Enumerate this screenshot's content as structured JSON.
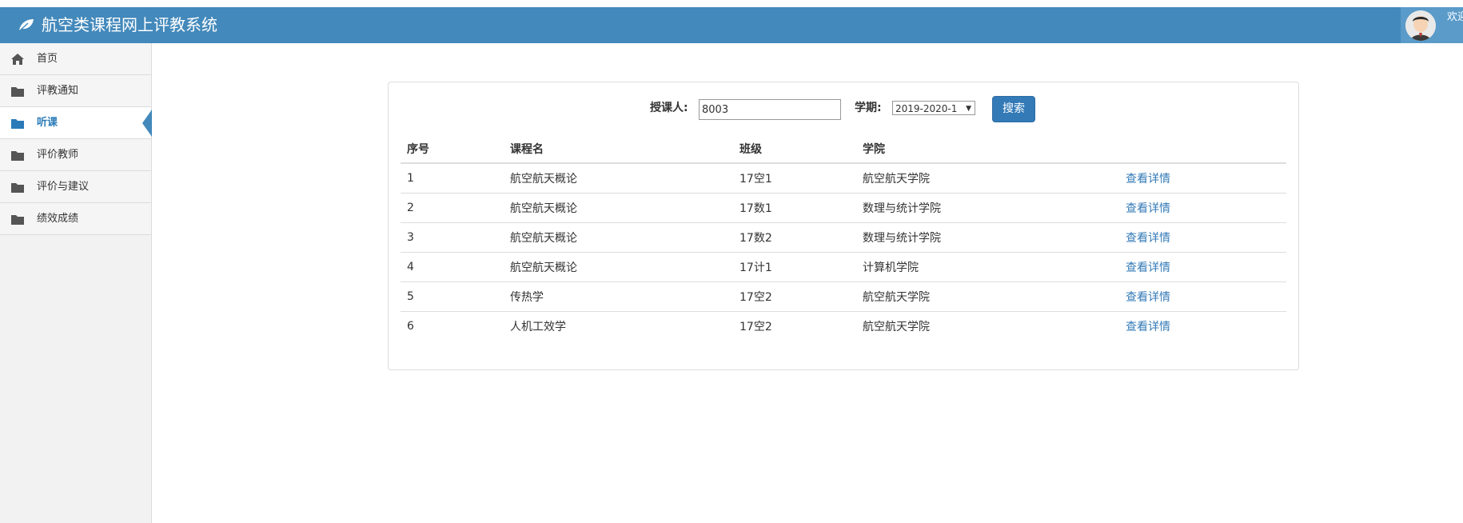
{
  "header": {
    "title": "航空类课程网上评教系统",
    "user_text": "欢迎 张三"
  },
  "sidebar": {
    "items": [
      {
        "label": "首页",
        "icon": "home-icon"
      },
      {
        "label": "评教通知",
        "icon": "folder-icon"
      },
      {
        "label": "听课",
        "icon": "folder-icon",
        "active": true
      },
      {
        "label": "评价教师",
        "icon": "folder-icon"
      },
      {
        "label": "评价与建议",
        "icon": "folder-icon"
      },
      {
        "label": "绩效成绩",
        "icon": "folder-icon"
      }
    ]
  },
  "search": {
    "teacher_label": "授课人:",
    "teacher_value": "8003",
    "term_label": "学期:",
    "term_value": "2019-2020-1",
    "button_label": "搜索"
  },
  "table": {
    "headers": [
      "序号",
      "课程名",
      "班级",
      "学院",
      ""
    ],
    "rows": [
      {
        "no": "1",
        "course": "航空航天概论",
        "class": "17空1",
        "college": "航空航天学院",
        "action": "查看详情"
      },
      {
        "no": "2",
        "course": "航空航天概论",
        "class": "17数1",
        "college": "数理与统计学院",
        "action": "查看详情"
      },
      {
        "no": "3",
        "course": "航空航天概论",
        "class": "17数2",
        "college": "数理与统计学院",
        "action": "查看详情"
      },
      {
        "no": "4",
        "course": "航空航天概论",
        "class": "17计1",
        "college": "计算机学院",
        "action": "查看详情"
      },
      {
        "no": "5",
        "course": "传热学",
        "class": "17空2",
        "college": "航空航天学院",
        "action": "查看详情"
      },
      {
        "no": "6",
        "course": "人机工效学",
        "class": "17空2",
        "college": "航空航天学院",
        "action": "查看详情"
      }
    ]
  },
  "colors": {
    "header_bg": "#4389bb",
    "accent": "#337ab7",
    "sidebar_bg": "#f2f2f2"
  }
}
